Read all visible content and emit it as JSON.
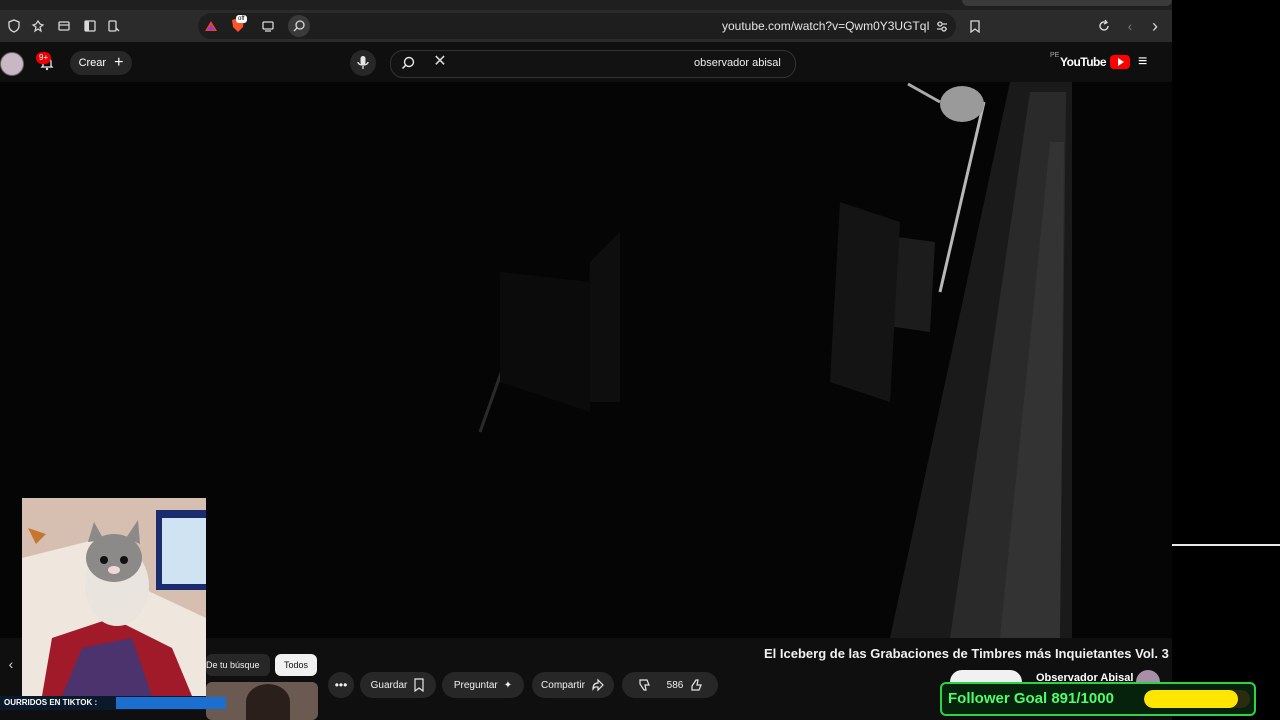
{
  "browser": {
    "url": "youtube.com/watch?v=Qwm0Y3UGTqI",
    "brave_badge": "off"
  },
  "header": {
    "create_label": "Crear",
    "notif_count": "9+",
    "search_query": "observador abisal",
    "logo_text": "YouTube",
    "region": "PE"
  },
  "video": {
    "title": "El Iceberg de las Grabaciones de Timbres más Inquietantes Vol. 3",
    "channel": "Observador Abisal",
    "likes": "586",
    "actions": {
      "share": "Compartir",
      "ask": "Preguntar",
      "save": "Guardar"
    }
  },
  "chips": {
    "all": "Todos",
    "from_search": "De tu búsque"
  },
  "overlay": {
    "ticker": "OURRIDOS EN TIKTOK :",
    "follower_goal": "Follower Goal 891/1000",
    "goal_current": 891,
    "goal_total": 1000
  },
  "colors": {
    "goal_border": "#2ed14a",
    "goal_fill": "#ffe600",
    "youtube_red": "#ff0000"
  }
}
